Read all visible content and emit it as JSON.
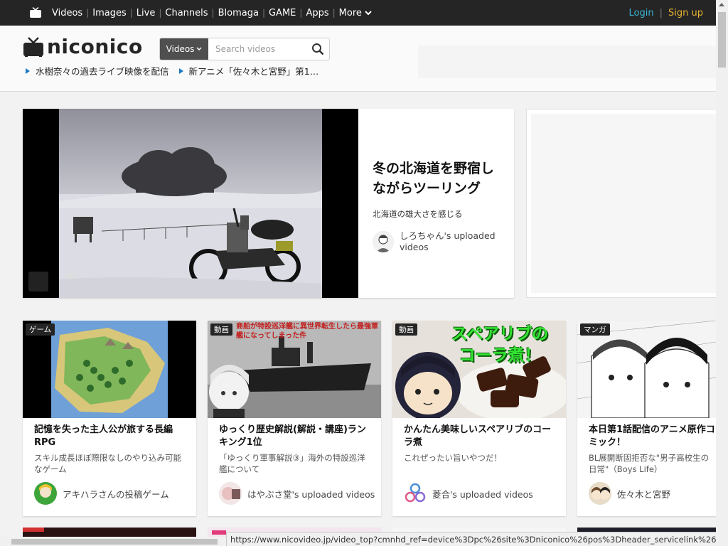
{
  "topbar": {
    "logo_icon": "niconico-tv-icon",
    "nav": [
      "Videos",
      "Images",
      "Live",
      "Channels",
      "Blomaga",
      "GAME",
      "Apps"
    ],
    "more_label": "More",
    "login_label": "Login",
    "signup_label": "Sign up",
    "colors": {
      "bg": "#252525",
      "login": "#3ab5d6",
      "signup": "#e8b534"
    }
  },
  "header": {
    "logo_text": "niconico",
    "search": {
      "category": "Videos",
      "placeholder": "Search videos",
      "button_icon": "search-icon"
    },
    "ticker": [
      "水樹奈々の過去ライブ映像を配信",
      "新アニメ「佐々木と宮野」第1…"
    ]
  },
  "feature": {
    "title": "冬の北海道を野宿しながらツーリング",
    "description": "北海道の雄大さを感じる",
    "uploader": "しろちゃん's uploaded videos",
    "mute_icon": "muted-speaker-icon"
  },
  "cards": [
    {
      "badge": "ゲーム",
      "title": "記憶を失った主人公が旅する長編RPG",
      "description": "スキル成長ほぼ際限なしのやり込み可能なゲーム",
      "uploader": "アキハラさんの投稿ゲーム"
    },
    {
      "badge": "動画",
      "thumb_caption": "商船が特設巡洋艦に異世界転生したら最強軍艦になってしまった件",
      "title": "ゆっくり歴史解説(解説・講座)ランキング1位",
      "description": "「ゆっくり軍事解説③」海外の特設巡洋艦について",
      "uploader": "はやぶさ堂's uploaded videos"
    },
    {
      "badge": "動画",
      "thumb_caption_line1": "スペアリブの",
      "thumb_caption_line2": "コーラ煮！",
      "title": "かんたん美味しいスペアリブのコーラ煮",
      "description": "これぜったい旨いやつだ！",
      "uploader": "菱合's uploaded videos"
    },
    {
      "badge": "マンガ",
      "title": "本日第1話配信のアニメ原作コミック！",
      "description": "BL展開断固拒否な\"男子高校生の日常\"（Boys Life）",
      "uploader": "佐々木と宮野"
    }
  ],
  "status_url": "https://www.nicovideo.jp/video_top?cmnhd_ref=device%3Dpc%26site%3Dniconico%26pos%3Dheader_servicelink%26page%3Dtop"
}
